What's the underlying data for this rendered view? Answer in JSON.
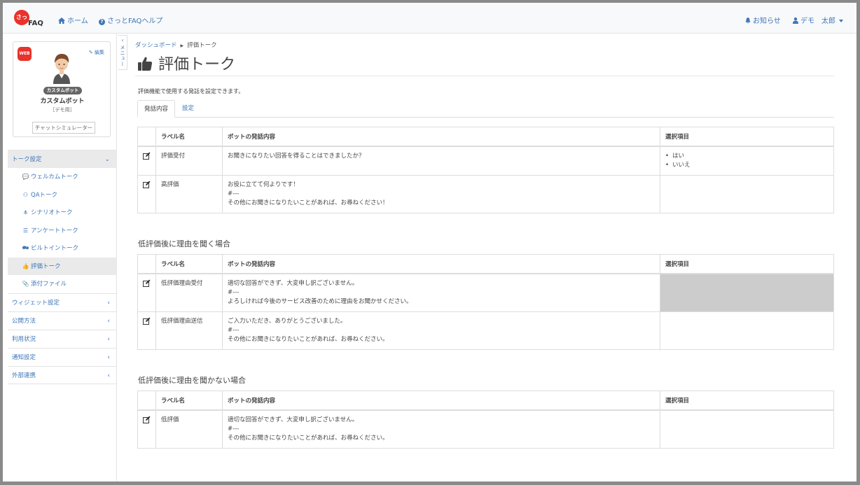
{
  "header": {
    "logo_text": "FAQ",
    "logo_char": "さっ",
    "nav": [
      {
        "label": "ホーム"
      },
      {
        "label": "さっとFAQヘルプ"
      }
    ],
    "notifications_label": "お知らせ",
    "user_label": "デモ　太郎"
  },
  "sidebar": {
    "web_badge": "WEB",
    "edit_label": "編集",
    "bot_pill": "カスタムボット",
    "bot_name": "カスタムボット",
    "bot_sub": "［デモ用］",
    "simulator_button": "チャットシミュレーター",
    "menu_toggle_label": "メニュー",
    "groups": [
      {
        "label": "トーク設定"
      },
      {
        "label": "ウィジェット設定"
      },
      {
        "label": "公開方法"
      },
      {
        "label": "利用状況"
      },
      {
        "label": "通知設定"
      },
      {
        "label": "外部連携"
      }
    ],
    "talk_items": [
      {
        "label": "ウェルカムトーク",
        "icon": "welcome-chat-icon"
      },
      {
        "label": "QAトーク",
        "icon": "qa-icon"
      },
      {
        "label": "シナリオトーク",
        "icon": "sitemap-icon"
      },
      {
        "label": "アンケートトーク",
        "icon": "list-icon"
      },
      {
        "label": "ビルトイントーク",
        "icon": "comments-icon"
      },
      {
        "label": "評価トーク",
        "icon": "thumbs-up-icon"
      },
      {
        "label": "添付ファイル",
        "icon": "paperclip-icon"
      }
    ]
  },
  "breadcrumb": {
    "parent": "ダッシュボード",
    "current": "評価トーク"
  },
  "page": {
    "title": "評価トーク",
    "description": "評価機能で使用する発話を設定できます。",
    "tabs": [
      {
        "label": "発話内容"
      },
      {
        "label": "設定"
      }
    ]
  },
  "table_headers": {
    "label": "ラベル名",
    "content": "ボットの発話内容",
    "options": "選択項目"
  },
  "table1": {
    "rows": [
      {
        "label": "評価受付",
        "lines": [
          "お聞きになりたい回答を得ることはできましたか？"
        ],
        "options": [
          "はい",
          "いいえ"
        ]
      },
      {
        "label": "高評価",
        "lines": [
          "お役に立てて何よりです！",
          "#---",
          "その他にお聞きになりたいことがあれば、お尋ねください！"
        ],
        "options": []
      }
    ]
  },
  "section2": {
    "title": "低評価後に理由を聞く場合",
    "rows": [
      {
        "label": "低評価理由受付",
        "lines": [
          "適切な回答ができず、大変申し訳ございません。",
          "#---",
          "よろしければ今後のサービス改善のために理由をお聞かせください。"
        ]
      },
      {
        "label": "低評価理由送信",
        "lines": [
          "ご入力いただき、ありがとうございました。",
          "#---",
          "その他にお聞きになりたいことがあれば、お尋ねください。"
        ]
      }
    ]
  },
  "section3": {
    "title": "低評価後に理由を聞かない場合",
    "rows": [
      {
        "label": "低評価",
        "lines": [
          "適切な回答ができず、大変申し訳ございません。",
          "#---",
          "その他にお聞きになりたいことがあれば、お尋ねください。"
        ]
      }
    ]
  }
}
